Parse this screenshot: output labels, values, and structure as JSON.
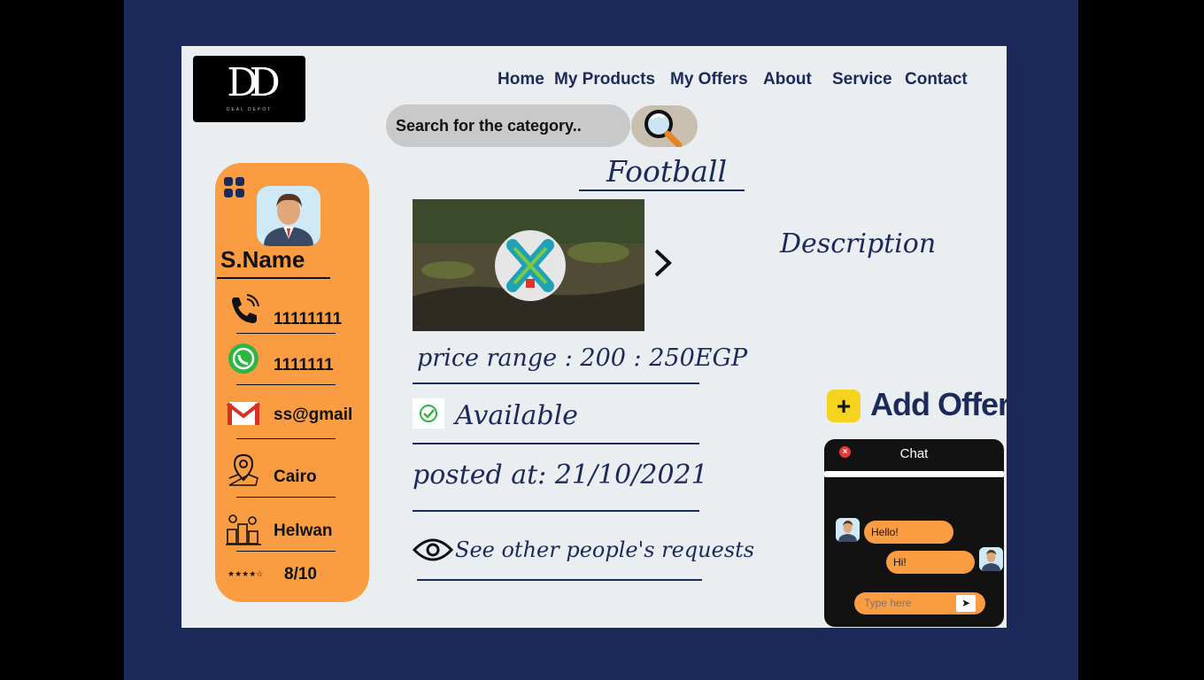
{
  "logo": {
    "mark": "DD",
    "tagline": "DEAL DEPOT"
  },
  "nav": [
    "Home",
    "My Products",
    "My Offers",
    "About",
    "Service",
    "Contact"
  ],
  "search": {
    "placeholder": "Search for the category.."
  },
  "profile": {
    "name": "S.Name",
    "phone": "11111111",
    "whatsapp": "1111111",
    "email": "ss@gmail",
    "city": "Cairo",
    "district": "Helwan",
    "rating": "8/10",
    "stars": "★★★★☆"
  },
  "product": {
    "title": "Football",
    "description_label": "Description",
    "price_range": "price range : 200 : 250EGP",
    "status": "Available",
    "posted": "posted at: 21/10/2021",
    "requests_link": "See other people's requests"
  },
  "add_offer": {
    "label": "Add Offer",
    "icon": "plus-icon"
  },
  "chat": {
    "title": "Chat",
    "messages": [
      {
        "from": "other",
        "text": "Hello!"
      },
      {
        "from": "me",
        "text": "Hi!"
      }
    ],
    "input_placeholder": "Type here"
  },
  "colors": {
    "navy": "#1b2a5a",
    "orange": "#fa9c41",
    "page": "#eaeef0",
    "yellow": "#f5d31e"
  }
}
